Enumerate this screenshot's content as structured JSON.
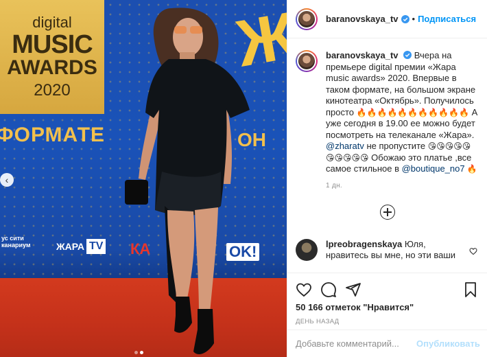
{
  "photo": {
    "logo_line1": "digital",
    "logo_line2": "MUSIC",
    "logo_line3": "AWARDS",
    "logo_line4": "2020",
    "banner_format": "ФОРМАТЕ",
    "banner_zhara": "Ж",
    "banner_v_on": "В ОН",
    "sponsor_city": "ус сити канариум",
    "sponsor_zhara": "ЖАРА",
    "sponsor_tv": "TV",
    "sponsor_ka": "КА",
    "sponsor_ok": "OK!",
    "prev_arrow": "‹",
    "carousel_total": 2,
    "carousel_active": 2
  },
  "header": {
    "username": "baranovskaya_tv",
    "separator": "•",
    "follow_label": "Подписаться"
  },
  "caption": {
    "username": "baranovskaya_tv",
    "text_part1": "Вчера на премьере digital премии «Жара music awards» 2020. Впервые в таком формате, на большом экране кинотеатра «Октябрь». Получилось просто ",
    "fire_emojis": "🔥🔥🔥🔥🔥🔥🔥🔥🔥🔥🔥",
    "text_part2": " А уже сегодня в 19.00 ее можно будет посмотреть на телеканале «Жара». ",
    "mention1": "@zharatv",
    "text_part3": " не пропустите ",
    "kiss_emojis": "😘😘😘😘😘😘😘😘😘😘",
    "text_part4": " Обожаю это платье ,все самое стильное в ",
    "mention2": "@boutique_no7",
    "text_part5": " 🔥",
    "time": "1 дн."
  },
  "comment": {
    "username": "lpreobragenskaya",
    "text": "Юля, нравитесь вы мне, но эти ваши"
  },
  "actions": {
    "likes": "50 166 отметок \"Нравится\"",
    "date": "ДЕНЬ НАЗАД",
    "comment_placeholder": "Добавьте комментарий...",
    "publish_label": "Опубликовать"
  },
  "colors": {
    "accent": "#0095f6",
    "publish_disabled": "#b2dffc"
  }
}
